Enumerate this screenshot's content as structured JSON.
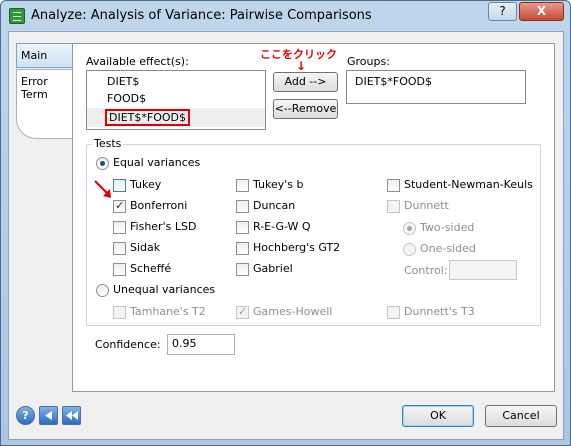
{
  "window": {
    "title": "Analyze: Analysis of Variance: Pairwise Comparisons",
    "help_glyph": "?",
    "close_glyph": "X",
    "app_icon": "table-icon"
  },
  "tabs": [
    {
      "label": "Main"
    },
    {
      "label": "Error Term"
    }
  ],
  "effects": {
    "label": "Available effect(s):",
    "items": [
      "DIET$",
      "FOOD$",
      "DIET$*FOOD$"
    ],
    "selected": "DIET$*FOOD$"
  },
  "buttons": {
    "add": "Add -->",
    "remove": "<--Remove",
    "ok": "OK",
    "cancel": "Cancel"
  },
  "annotation": {
    "text": "ここをクリック",
    "arrow": "↓",
    "color": "#e00000"
  },
  "groups": {
    "label": "Groups:",
    "items": [
      "DIET$*FOOD$"
    ]
  },
  "tests": {
    "title": "Tests",
    "equal_variances": "Equal variances",
    "equal_col1": [
      {
        "label": "Tukey",
        "checked": false
      },
      {
        "label": "Bonferroni",
        "checked": true
      },
      {
        "label": "Fisher's LSD",
        "checked": false
      },
      {
        "label": "Sidak",
        "checked": false
      },
      {
        "label": "Scheffé",
        "checked": false
      }
    ],
    "equal_col2": [
      {
        "label": "Tukey's b",
        "checked": false
      },
      {
        "label": "Duncan",
        "checked": false
      },
      {
        "label": "R-E-G-W Q",
        "checked": false
      },
      {
        "label": "Hochberg's GT2",
        "checked": false
      },
      {
        "label": "Gabriel",
        "checked": false
      }
    ],
    "equal_col3": [
      {
        "label": "Student-Newman-Keuls",
        "checked": false
      },
      {
        "label": "Dunnett",
        "checked": false,
        "disabled": true
      }
    ],
    "dunnett_two_sided": "Two-sided",
    "dunnett_one_sided": "One-sided",
    "control_label": "Control:",
    "control_value": "",
    "unequal_variances": "Unequal variances",
    "unequal": [
      {
        "label": "Tamhane's T2",
        "checked": false
      },
      {
        "label": "Games-Howell",
        "checked": true
      },
      {
        "label": "Dunnett's T3",
        "checked": false
      }
    ]
  },
  "confidence": {
    "label": "Confidence:",
    "value": "0.95"
  },
  "footer_icons": [
    "help-icon",
    "back-icon",
    "rewind-icon"
  ]
}
